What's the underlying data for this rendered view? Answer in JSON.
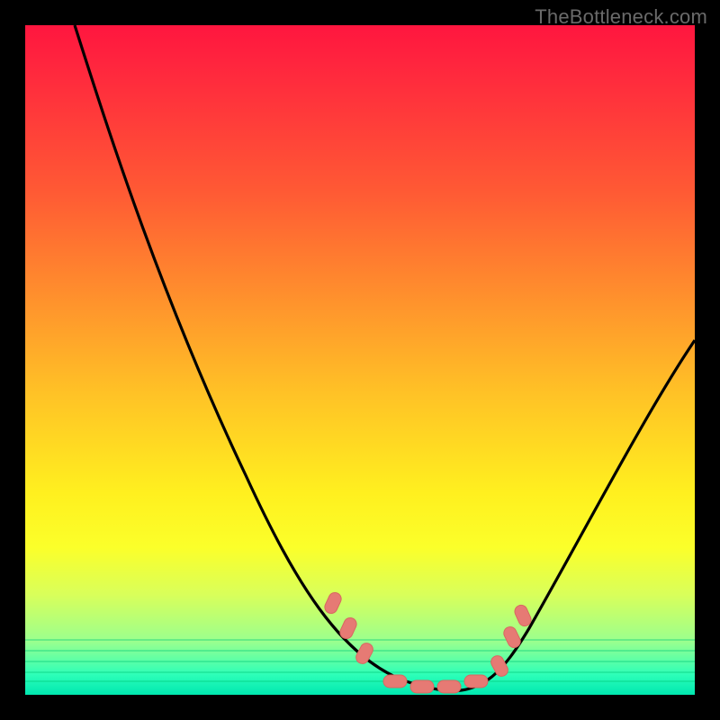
{
  "watermark": "TheBottleneck.com",
  "colors": {
    "page_bg": "#000000",
    "gradient_top": "#ff163f",
    "gradient_bottom": "#00e7b0",
    "curve_stroke": "#000000",
    "marker_fill": "#e67a74",
    "watermark_text": "#6a6a6a"
  },
  "chart_data": {
    "type": "line",
    "title": "",
    "xlabel": "",
    "ylabel": "",
    "xlim": [
      0,
      100
    ],
    "ylim": [
      0,
      100
    ],
    "grid": false,
    "legend": false,
    "series": [
      {
        "name": "bottleneck-curve",
        "x": [
          7,
          12,
          18,
          24,
          30,
          36,
          42,
          46,
          50,
          54,
          58,
          62,
          66,
          70,
          76,
          82,
          88,
          94,
          100
        ],
        "y": [
          100,
          87,
          74,
          61,
          48,
          36,
          24,
          15,
          8,
          3,
          1,
          0,
          0,
          3,
          10,
          20,
          31,
          42,
          53
        ]
      }
    ],
    "markers": [
      {
        "x": 46,
        "y": 13
      },
      {
        "x": 48,
        "y": 9
      },
      {
        "x": 50,
        "y": 5
      },
      {
        "x": 55,
        "y": 1
      },
      {
        "x": 59,
        "y": 0
      },
      {
        "x": 63,
        "y": 0
      },
      {
        "x": 67,
        "y": 1
      },
      {
        "x": 70,
        "y": 3
      },
      {
        "x": 71.5,
        "y": 8
      },
      {
        "x": 73,
        "y": 12
      }
    ]
  }
}
